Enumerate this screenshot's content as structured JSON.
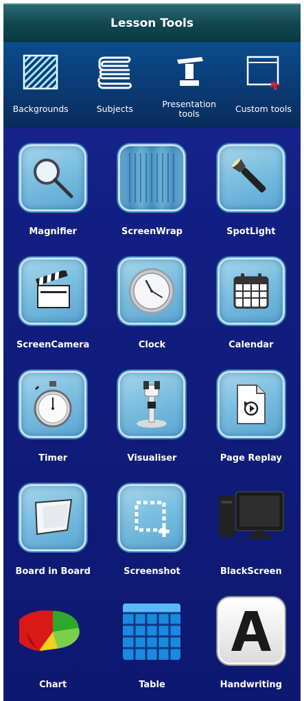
{
  "panel": {
    "title": "Lesson Tools"
  },
  "top": [
    {
      "label": "Backgrounds",
      "icon": "hatched-square-icon"
    },
    {
      "label": "Subjects",
      "icon": "books-icon"
    },
    {
      "label": "Presentation tools",
      "icon": "podium-icon"
    },
    {
      "label": "Custom tools",
      "icon": "window-icon"
    }
  ],
  "tools": [
    {
      "label": "Magnifier",
      "icon": "magnifier-icon"
    },
    {
      "label": "ScreenWrap",
      "icon": "curtain-icon"
    },
    {
      "label": "SpotLight",
      "icon": "flashlight-icon"
    },
    {
      "label": "ScreenCamera",
      "icon": "clapperboard-icon"
    },
    {
      "label": "Clock",
      "icon": "clock-icon"
    },
    {
      "label": "Calendar",
      "icon": "calendar-icon"
    },
    {
      "label": "Timer",
      "icon": "stopwatch-icon"
    },
    {
      "label": "Visualiser",
      "icon": "microscope-icon"
    },
    {
      "label": "Page Replay",
      "icon": "page-replay-icon"
    },
    {
      "label": "Board in Board",
      "icon": "board-icon"
    },
    {
      "label": "Screenshot",
      "icon": "screenshot-icon"
    },
    {
      "label": "BlackScreen",
      "icon": "monitor-icon"
    },
    {
      "label": "Chart",
      "icon": "pie-chart-icon"
    },
    {
      "label": "Table",
      "icon": "table-icon"
    },
    {
      "label": "Handwriting",
      "icon": "letter-a-icon"
    }
  ],
  "colors": {
    "panel_bg": "#121f82",
    "title_bar": "#10464e",
    "top_bar": "#0a3b74",
    "tile": "#7cbfe0",
    "text": "#ffffff"
  }
}
